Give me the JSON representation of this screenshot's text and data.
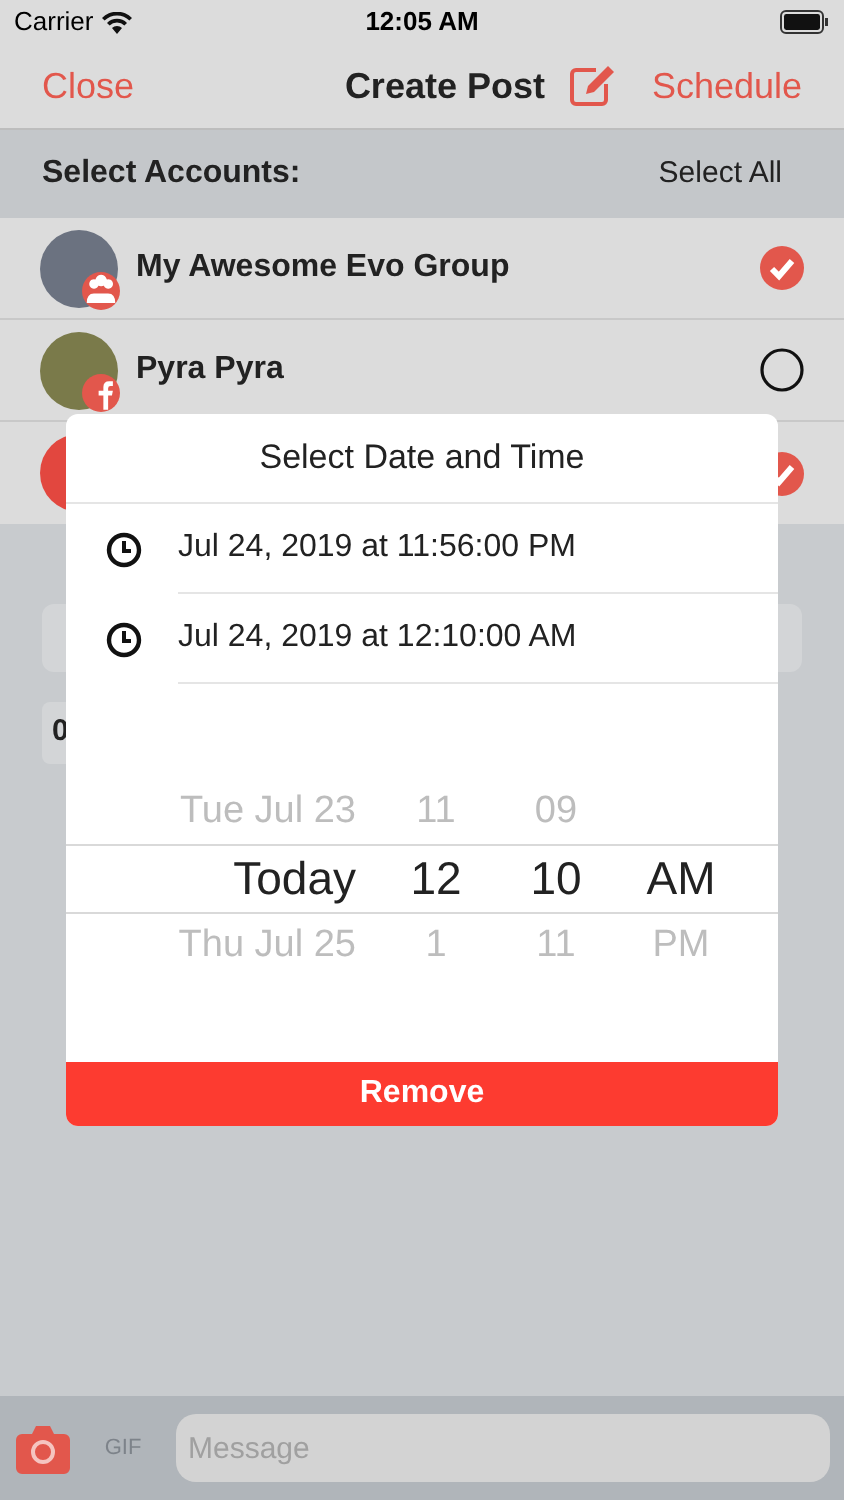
{
  "status_bar": {
    "carrier": "Carrier",
    "time": "12:05 AM"
  },
  "nav": {
    "close": "Close",
    "title": "Create Post",
    "schedule": "Schedule"
  },
  "accounts_header": {
    "title": "Select Accounts:",
    "select_all": "Select All"
  },
  "accounts": [
    {
      "name": "My Awesome Evo Group",
      "kind": "group",
      "selected": true,
      "color": "#6b7280"
    },
    {
      "name": "Pyra Pyra",
      "kind": "facebook",
      "selected": false,
      "color": "#7a7a4a"
    },
    {
      "kind": "red",
      "selected": true,
      "color": "#e2473f"
    }
  ],
  "counter": "0",
  "dialog": {
    "title": "Select Date and Time",
    "times": [
      {
        "label": "Jul 24, 2019 at 11:56:00 PM"
      },
      {
        "label": "Jul 24, 2019 at 12:10:00 AM"
      }
    ],
    "picker": [
      {
        "day": "Tue Jul 23",
        "hour": "11",
        "minute": "09",
        "selected": false
      },
      {
        "day": "Today",
        "hour": "12",
        "minute": "10",
        "period": "AM",
        "selected": true
      },
      {
        "day": "Thu Jul 25",
        "hour": "1",
        "minute": "11",
        "period": "PM",
        "selected": false
      }
    ],
    "remove": "Remove"
  },
  "composer": {
    "gif": "GIF",
    "placeholder": "Message"
  }
}
